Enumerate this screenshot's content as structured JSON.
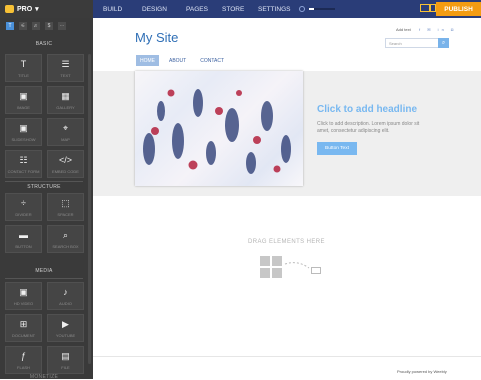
{
  "topbar": {
    "brand": "PRO",
    "nav": [
      "BUILD",
      "DESIGN",
      "PAGES",
      "STORE",
      "SETTINGS"
    ],
    "publish": "PUBLISH",
    "autosave_progress_fraction": 0.2
  },
  "sidebar": {
    "tabs": [
      "T",
      "⚟",
      "♬",
      "$",
      "⋯"
    ],
    "sections": {
      "basic": "BASIC",
      "structure": "STRUCTURE",
      "media": "MEDIA"
    },
    "tiles": [
      {
        "icon": "T",
        "label": "TITLE",
        "name": "title"
      },
      {
        "icon": "☰",
        "label": "TEXT",
        "name": "text"
      },
      {
        "icon": "▣",
        "label": "IMAGE",
        "name": "image"
      },
      {
        "icon": "▦",
        "label": "GALLERY",
        "name": "gallery"
      },
      {
        "icon": "▣",
        "label": "SLIDESHOW",
        "name": "slideshow"
      },
      {
        "icon": "⌖",
        "label": "MAP",
        "name": "map"
      },
      {
        "icon": "☷",
        "label": "CONTACT FORM",
        "name": "contact-form"
      },
      {
        "icon": "</>",
        "label": "EMBED CODE",
        "name": "embed-code"
      },
      {
        "icon": "÷",
        "label": "DIVIDER",
        "name": "divider"
      },
      {
        "icon": "⬚",
        "label": "SPACER",
        "name": "spacer"
      },
      {
        "icon": "▬",
        "label": "BUTTON",
        "name": "button"
      },
      {
        "icon": "⌕",
        "label": "SEARCH BOX",
        "name": "search-box"
      },
      {
        "icon": "▣",
        "label": "HD VIDEO",
        "name": "hd-video"
      },
      {
        "icon": "♪",
        "label": "AUDIO",
        "name": "audio"
      },
      {
        "icon": "⊞",
        "label": "DOCUMENT",
        "name": "document"
      },
      {
        "icon": "▶",
        "label": "YOUTUBE",
        "name": "youtube"
      },
      {
        "icon": "ƒ",
        "label": "FLASH",
        "name": "flash"
      },
      {
        "icon": "▤",
        "label": "FILE",
        "name": "file"
      }
    ],
    "bottom_label": "MONETIZE"
  },
  "site": {
    "title": "My Site",
    "add_text": "Add text",
    "social": "f  ✉  in  ◘",
    "search_placeholder": "Search",
    "menu": [
      "HOME",
      "ABOUT",
      "CONTACT"
    ],
    "headline": "Click to add headline",
    "description": "Click to add description. Lorem ipsum dolor sit amet, consectetur adipiscing elit.",
    "button_text": "Button Text",
    "drag_text": "DRAG ELEMENTS HERE",
    "footer": "Proudly powered by Weebly"
  }
}
